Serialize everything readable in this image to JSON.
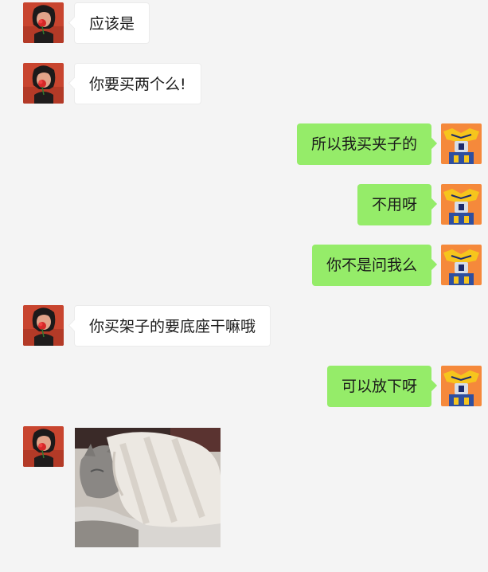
{
  "messages": [
    {
      "sender": "other",
      "text": "应该是"
    },
    {
      "sender": "other",
      "text": "你要买两个么!"
    },
    {
      "sender": "self",
      "text": "所以我买夹子的"
    },
    {
      "sender": "self",
      "text": "不用呀"
    },
    {
      "sender": "self",
      "text": "你不是问我么"
    },
    {
      "sender": "other",
      "text": "你买架子的要底座干嘛哦"
    },
    {
      "sender": "self",
      "text": "可以放下呀"
    },
    {
      "sender": "other",
      "image": "cat-under-blanket-sticker"
    }
  ],
  "colors": {
    "background": "#f4f4f4",
    "self_bubble": "#95ec69",
    "other_bubble": "#ffffff",
    "other_avatar_bg": "#c8452f",
    "self_avatar_bg": "#f5893b"
  },
  "avatars": {
    "other": "woman-with-red-flower-avatar",
    "self": "yellow-robot-avatar"
  }
}
